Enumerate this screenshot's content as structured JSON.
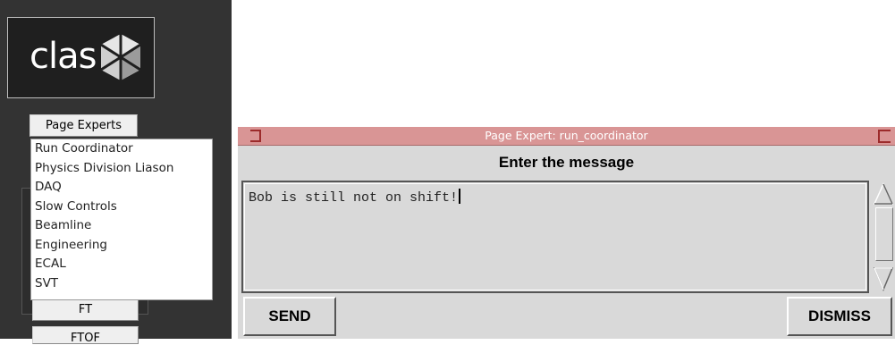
{
  "logo": {
    "text": "clas",
    "icon": "cube-logo-icon"
  },
  "page_experts_button": "Page Experts",
  "dropdown_items": [
    "Run Coordinator",
    "Physics Division Liason",
    "DAQ",
    "Slow Controls",
    "Beamline",
    "Engineering",
    "ECAL",
    "SVT"
  ],
  "side_buttons": [
    "FT",
    "FTOF"
  ],
  "dialog": {
    "title": "Page Expert:  run_coordinator",
    "heading": "Enter the message",
    "message": "Bob is still not on shift!",
    "send_label": "SEND",
    "dismiss_label": "DISMISS"
  },
  "colors": {
    "panel_bg": "#333333",
    "titlebar": "#d99595",
    "dialog_bg": "#d9d9d9"
  }
}
